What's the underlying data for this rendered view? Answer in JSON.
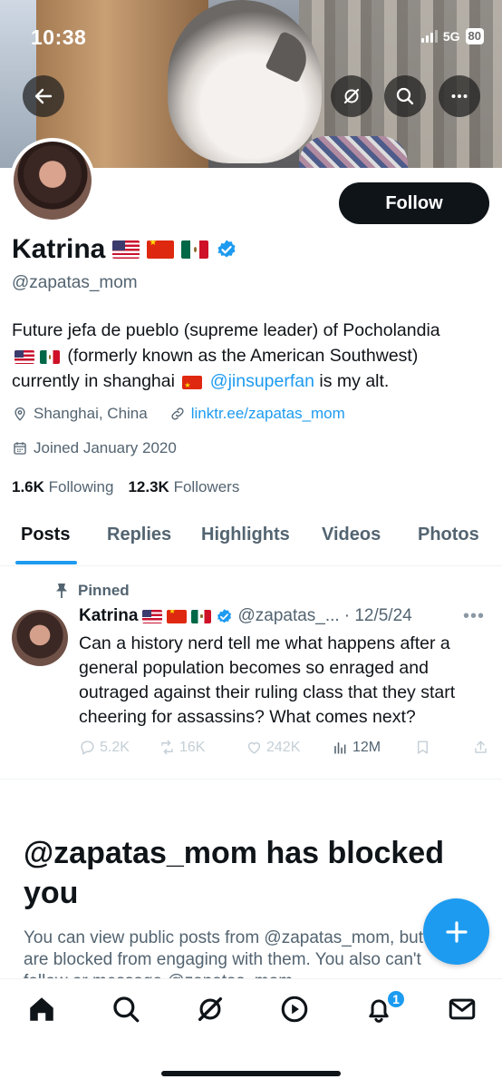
{
  "status_bar": {
    "time": "10:38",
    "network": "5G",
    "battery": "80"
  },
  "header": {
    "back_icon": "arrow-left-icon",
    "grok_icon": "grok-icon",
    "search_icon": "search-icon",
    "more_icon": "more-horizontal-icon"
  },
  "profile": {
    "name": "Katrina",
    "flags": [
      "us",
      "cn",
      "mx"
    ],
    "handle": "@zapatas_mom",
    "follow_label": "Follow",
    "bio": {
      "line1": "Future jefa de pueblo (supreme leader) of Pocholandia",
      "line2": "(formerly known as the American Southwest)",
      "line3_pre": "currently in shanghai",
      "mention": "@jinsuperfan",
      "line3_post": "is my alt."
    },
    "location": "Shanghai, China",
    "website": "linktr.ee/zapatas_mom",
    "joined": "Joined January 2020",
    "following_count": "1.6K",
    "following_label": "Following",
    "followers_count": "12.3K",
    "followers_label": "Followers"
  },
  "tabs": [
    "Posts",
    "Replies",
    "Highlights",
    "Videos",
    "Photos"
  ],
  "active_tab": "Posts",
  "pinned_post": {
    "pinned_label": "Pinned",
    "author": "Katrina",
    "handle": "@zapatas_...",
    "date": "· 12/5/24",
    "text": "Can a history nerd tell me what happens after a general population becomes so enraged and outraged against their ruling class that they start cheering for assassins? What comes next?",
    "replies": "5.2K",
    "reposts": "16K",
    "likes": "242K",
    "views": "12M"
  },
  "blocked": {
    "title": "@zapatas_mom has blocked you",
    "text": "You can view public posts from @zapatas_mom, but you are blocked from engaging with them. You also can't follow or message @zapatas_mom."
  },
  "nav": {
    "items": [
      "home-icon",
      "search-icon",
      "grok-icon",
      "video-icon",
      "notifications-icon",
      "messages-icon"
    ],
    "notification_badge": "1"
  },
  "colors": {
    "accent": "#1d9bf0",
    "text": "#0f1419",
    "muted": "#536471"
  }
}
